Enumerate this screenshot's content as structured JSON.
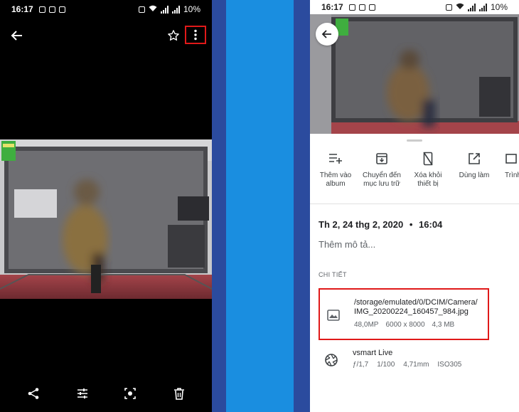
{
  "left_phone": {
    "status": {
      "time": "16:17",
      "battery": "10%"
    },
    "bottom_actions": [
      "share-icon",
      "edit-icon",
      "lens-icon",
      "delete-icon"
    ]
  },
  "right_phone": {
    "status": {
      "time": "16:17",
      "battery": "10%"
    },
    "actions": [
      {
        "label_line1": "Thêm vào",
        "label_line2": "album",
        "icon": "playlist-add-icon"
      },
      {
        "label_line1": "Chuyển đến",
        "label_line2": "mục lưu trữ",
        "icon": "archive-icon"
      },
      {
        "label_line1": "Xóa khỏi",
        "label_line2": "thiết bị",
        "icon": "delete-from-device-icon"
      },
      {
        "label_line1": "Dùng làm",
        "label_line2": "",
        "icon": "open-in-icon"
      },
      {
        "label_line1": "Trình",
        "label_line2": "",
        "icon": "slideshow-icon"
      }
    ],
    "date": "Th 2, 24 thg 2, 2020",
    "date_sep": "•",
    "time_taken": "16:04",
    "description_placeholder": "Thêm mô tả...",
    "section_label": "CHI TIẾT",
    "file": {
      "path_line1": "/storage/emulated/0/DCIM/Camera/",
      "path_line2": "IMG_20200224_160457_984.jpg",
      "megapixels": "48,0MP",
      "resolution": "6000 x 8000",
      "size": "4,3 MB"
    },
    "camera": {
      "name": "vsmart Live",
      "aperture": "ƒ/1,7",
      "shutter": "1/100",
      "focal": "4,71mm",
      "iso": "ISO305"
    }
  },
  "colors": {
    "highlight": "#e01919",
    "blue_dark": "#2b4b9e",
    "blue_mid": "#1a8ee0"
  }
}
